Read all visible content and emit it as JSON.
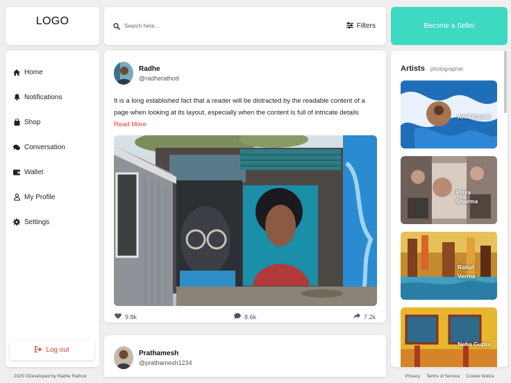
{
  "logo": {
    "text": "LOGO"
  },
  "search": {
    "placeholder": "Search here...",
    "filters_label": "Filters"
  },
  "seller_button": {
    "label": "Become a Seller"
  },
  "sidebar": {
    "items": [
      {
        "label": "Home",
        "icon": "home-icon"
      },
      {
        "label": "Notifications",
        "icon": "bell-icon"
      },
      {
        "label": "Shop",
        "icon": "shopping-bag-icon"
      },
      {
        "label": "Conversation",
        "icon": "chat-icon"
      },
      {
        "label": "Wallet",
        "icon": "wallet-icon"
      },
      {
        "label": "My Profile",
        "icon": "user-icon"
      },
      {
        "label": "Settings",
        "icon": "gear-icon"
      }
    ],
    "logout_label": "Log out"
  },
  "posts": [
    {
      "name": "Radhe",
      "handle": "@radherathod",
      "text": "It is a long established fact that a reader will be distracted by the readable content of a page when looking at its layout, especially when the content is full of intricate details",
      "read_more": "Read More",
      "likes": "9.8k",
      "comments": "8.6k",
      "shares": "7.2k"
    },
    {
      "name": "Prathamesh",
      "handle": "@prathamesh1234"
    }
  ],
  "artists": {
    "title": "Artists",
    "tab_photographer": "photographer",
    "list": [
      {
        "name_line1": "Amit Kumar",
        "name_line2": ""
      },
      {
        "name_line1": "Priya",
        "name_line2": "Sharma"
      },
      {
        "name_line1": "Rahul",
        "name_line2": "Verma"
      },
      {
        "name_line1": "Neha Gupta",
        "name_line2": ""
      }
    ]
  },
  "footer": {
    "copyright": "2025 ©Developed by Radhe Rathod",
    "links": [
      "Privacy",
      "Terms of Service",
      "Cookie Notice"
    ]
  },
  "colors": {
    "accent": "#3dd9c1",
    "danger": "#e03a3a",
    "background": "#efefef"
  }
}
